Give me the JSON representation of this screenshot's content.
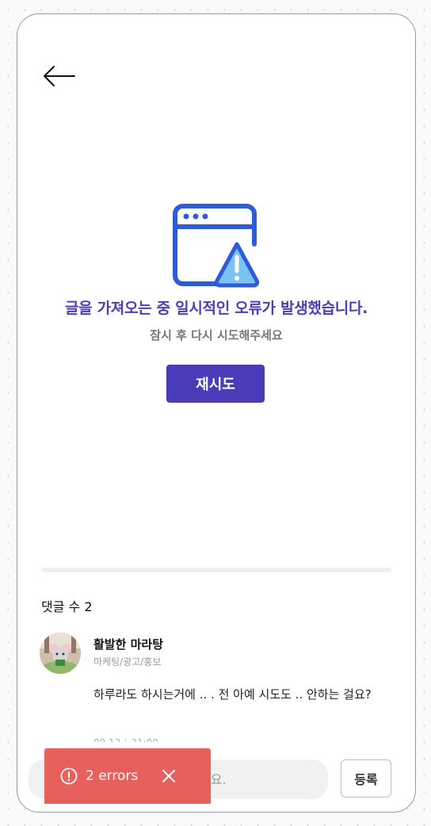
{
  "nav": {
    "back_icon": "arrow-left-icon"
  },
  "error_state": {
    "icon": "browser-window-warning-icon",
    "title": "글을 가져오는 중 일시적인 오류가 발생했습니다.",
    "subtitle": "잠시 후 다시 시도해주세요",
    "retry_label": "재시도"
  },
  "comments": {
    "count_label": "댓글 수 2",
    "items": [
      {
        "author": "활발한 마라탕",
        "category": "마케팅/광고/홍보",
        "body": "하루라도 하시는거에 .. . 전 아예 시도도 .. 안하는 걸요?",
        "date": "00.12",
        "time": "21:00"
      }
    ]
  },
  "composer": {
    "placeholder": "세요.",
    "submit_label": "등록"
  },
  "toast": {
    "label": "2 errors",
    "icon": "alert-circle-icon",
    "close_icon": "close-icon"
  },
  "colors": {
    "accent": "#4a3cb8",
    "title": "#4a3fb3",
    "icon_blue": "#2e5bdc",
    "toast_bg": "#e8605b"
  }
}
